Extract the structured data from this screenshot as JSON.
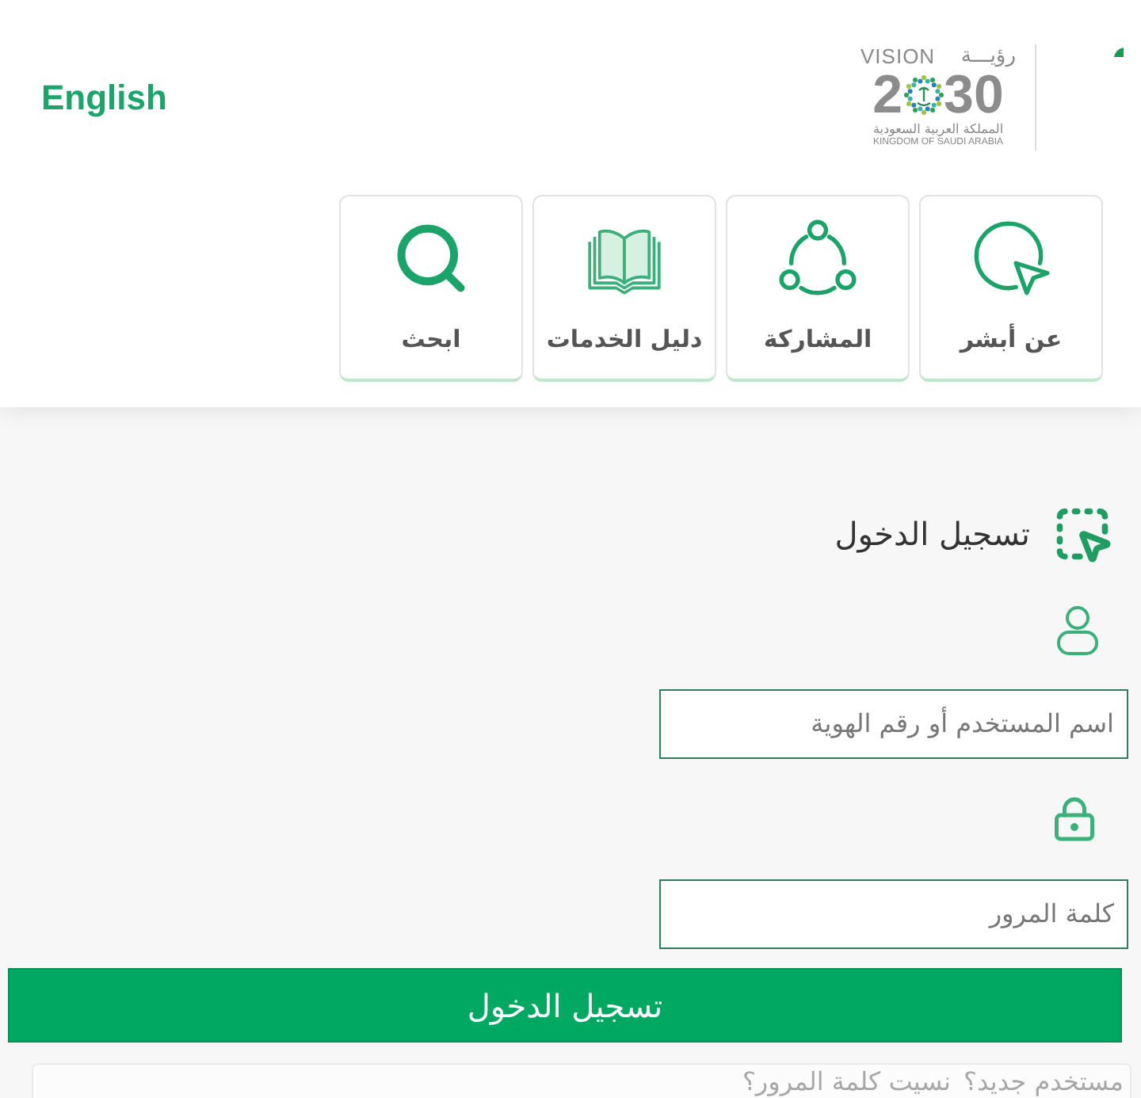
{
  "header": {
    "language_link": "English",
    "logo": {
      "vision": "VISION",
      "vision_ar": "رؤيـــة",
      "year_start": "2",
      "year_end": "30",
      "name_ar": "المملكة العربية السعودية",
      "name_en": "KINGDOM OF SAUDI ARABIA"
    }
  },
  "tiles": [
    {
      "label": "عن أبشر"
    },
    {
      "label": "المشاركة"
    },
    {
      "label": "دليل الخدمات"
    },
    {
      "label": "ابحث"
    }
  ],
  "login": {
    "title": "تسجيل الدخول",
    "fields": [
      {
        "placeholder": "اسم المستخدم أو رقم الهوية"
      },
      {
        "placeholder": "كلمة المرور"
      }
    ],
    "submit": "تسجيل الدخول",
    "footer_links": [
      "مستخدم جديد؟",
      "نسيت كلمة المرور؟"
    ]
  }
}
